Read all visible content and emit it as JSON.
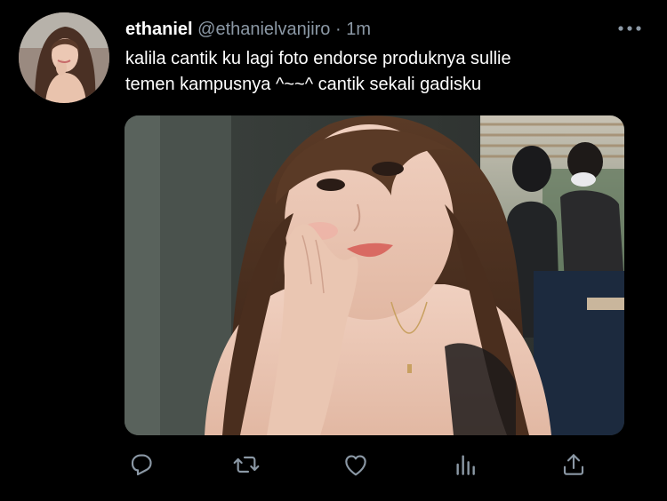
{
  "tweet": {
    "display_name": "ethaniel",
    "handle": "@ethanielvanjiro",
    "separator": "·",
    "time": "1m",
    "text_lines": [
      "kalila cantik ku lagi foto endorse produknya sullie",
      "temen kampusnya ^~~^ cantik sekali gadisku"
    ]
  },
  "actions": {
    "reply_icon": "reply-icon",
    "retweet_icon": "retweet-icon",
    "like_icon": "heart-icon",
    "analytics_icon": "analytics-icon",
    "share_icon": "share-icon"
  },
  "colors": {
    "background": "#000000",
    "text_primary": "#ffffff",
    "text_secondary": "#8b98a5",
    "icon": "#8b98a5"
  }
}
